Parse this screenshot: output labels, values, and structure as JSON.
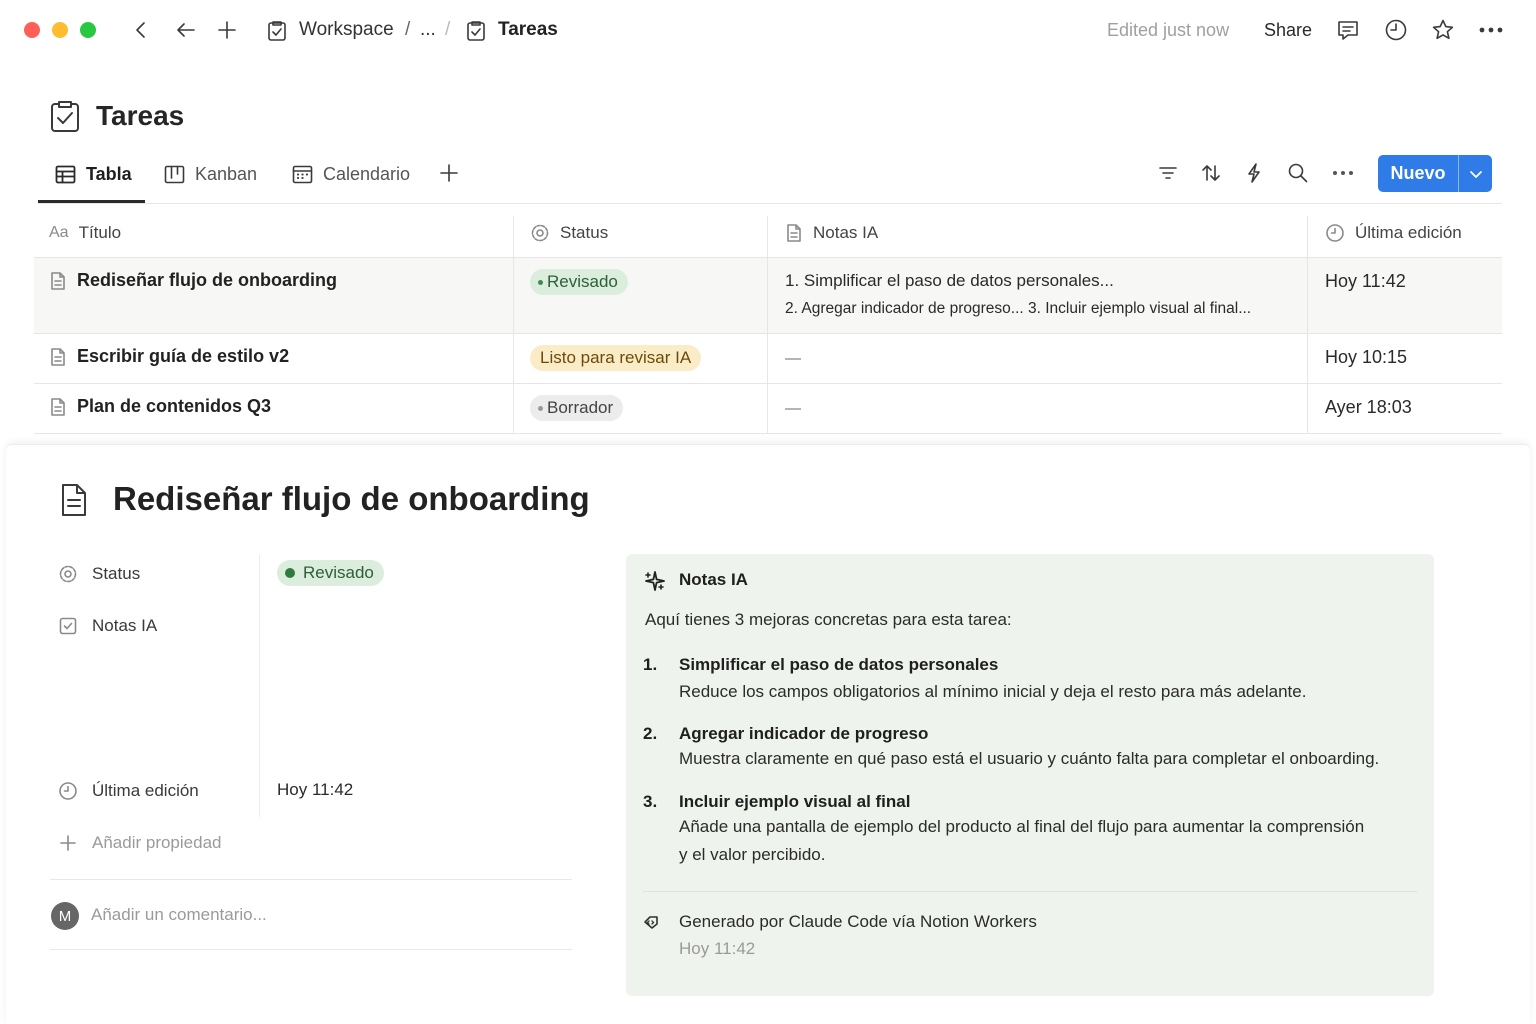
{
  "window": {
    "traffic_colors": [
      "#ff5f57",
      "#febc2e",
      "#28c840"
    ]
  },
  "topbar": {
    "breadcrumb_workspace": "Workspace",
    "breadcrumb_sep": "/",
    "breadcrumb_ellipsis": "...",
    "breadcrumb_page": "Tareas",
    "edited": "Edited just now",
    "share": "Share"
  },
  "page": {
    "title": "Tareas"
  },
  "views": {
    "tabs": [
      {
        "label": "Tabla",
        "icon": "table-icon",
        "active": true
      },
      {
        "label": "Kanban",
        "icon": "kanban-icon",
        "active": false
      },
      {
        "label": "Calendario",
        "icon": "calendar-icon",
        "active": false
      }
    ],
    "new_button": "Nuevo"
  },
  "table": {
    "headers": {
      "title_prefix": "Aa",
      "title": "Título",
      "status": "Status",
      "notes": "Notas IA",
      "edited": "Última edición"
    },
    "rows": [
      {
        "title": "Rediseñar flujo de onboarding",
        "status": "Revisado",
        "notes_line1": "1. Simplificar el paso de datos personales...",
        "notes_line2": "2. Agregar indicador de progreso... 3. Incluir ejemplo visual al final...",
        "edited": "Hoy 11:42"
      },
      {
        "title": "Escribir guía de estilo v2",
        "status": "Listo para revisar IA",
        "notes_line1": "",
        "notes_line2": "",
        "edited": "Hoy 10:15"
      },
      {
        "title": "Plan de contenidos Q3",
        "status": "Borrador",
        "notes_line1": "",
        "notes_line2": "",
        "edited": "Ayer 18:03"
      }
    ],
    "status_colors": {
      "Revisado": {
        "bg": "#dbeedd",
        "dot": "#3f8a4e"
      },
      "Listo para revisar IA": {
        "bg": "#fbecc8",
        "dot": "#c99a2e"
      },
      "Borrador": {
        "bg": "#ececec",
        "dot": "#999999"
      }
    }
  },
  "detail": {
    "title": "Rediseñar flujo de onboarding",
    "properties": {
      "status_label": "Status",
      "status_value": "Revisado",
      "notes_label": "Notas IA",
      "edited_label": "Última edición",
      "edited_value": "Hoy 11:42",
      "add_property": "Añadir propiedad"
    },
    "comment": {
      "avatar_initial": "M",
      "placeholder": "Añadir un comentario..."
    },
    "ai_notes": {
      "heading": "Notas IA",
      "intro": "Aquí tienes 3 mejoras concretas para esta tarea:",
      "items": [
        {
          "num": "1.",
          "title": "Simplificar el paso de datos personales",
          "body": "Reduce los campos obligatorios al mínimo inicial y deja el resto para más adelante.",
          "body2": ""
        },
        {
          "num": "2.",
          "title": "Agregar indicador de progreso",
          "body": "Muestra claramente en qué paso está el usuario y cuánto falta para completar el onboarding.",
          "body2": ""
        },
        {
          "num": "3.",
          "title": "Incluir ejemplo visual al final",
          "body": "Añade una pantalla de ejemplo del producto al final del flujo para aumentar la comprensión",
          "body2": "y el valor percibido."
        }
      ],
      "generated_by": "Generado por Claude Code vía Notion Workers",
      "generated_time": "Hoy 11:42"
    }
  },
  "colors": {
    "accent": "#2f7be8",
    "ai_card_bg": "#eff3ed"
  }
}
